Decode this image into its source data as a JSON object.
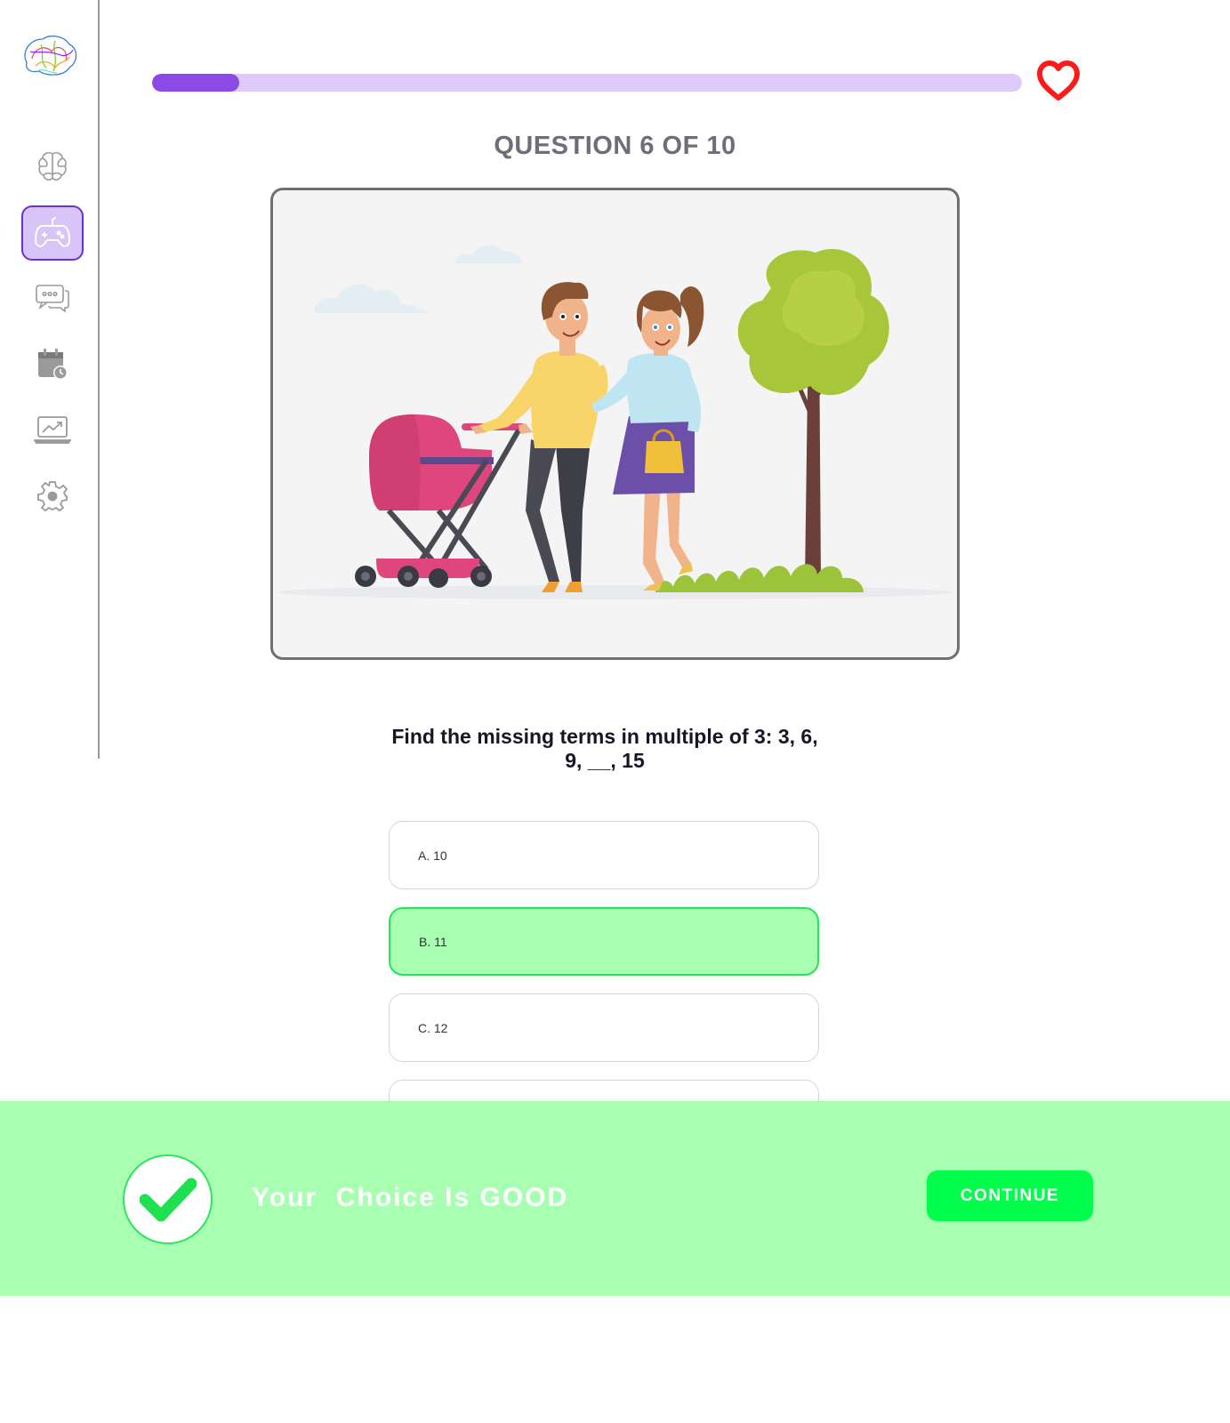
{
  "app": {
    "accent_color": "#8b4ae6",
    "success_color": "#00ff4c"
  },
  "sidebar": {
    "logo_icon": "brain-logo-icon",
    "items": [
      {
        "id": "brain",
        "icon": "brain-icon",
        "active": false
      },
      {
        "id": "games",
        "icon": "gamepad-icon",
        "active": true
      },
      {
        "id": "chat",
        "icon": "chat-bubbles-icon",
        "active": false
      },
      {
        "id": "schedule",
        "icon": "calendar-clock-icon",
        "active": false
      },
      {
        "id": "progress",
        "icon": "laptop-chart-icon",
        "active": false
      },
      {
        "id": "settings",
        "icon": "gear-icon",
        "active": false
      }
    ]
  },
  "quiz": {
    "progress_fraction": 0.1,
    "lives_icon": "heart-icon",
    "question_counter": "QUESTION 6 OF 10",
    "illustration": "family-walking-with-stroller-illustration",
    "question_text": "Find the missing terms in multiple of 3: 3, 6, 9, __, 15",
    "options": [
      {
        "label": "A. 10",
        "selected": false
      },
      {
        "label": "B. 11",
        "selected": true
      },
      {
        "label": "C. 12",
        "selected": false
      }
    ]
  },
  "feedback": {
    "icon": "checkmark-icon",
    "message": "Your  Choice Is GOOD",
    "continue_label": "CONTINUE",
    "background_color": "#a8ffb2"
  }
}
